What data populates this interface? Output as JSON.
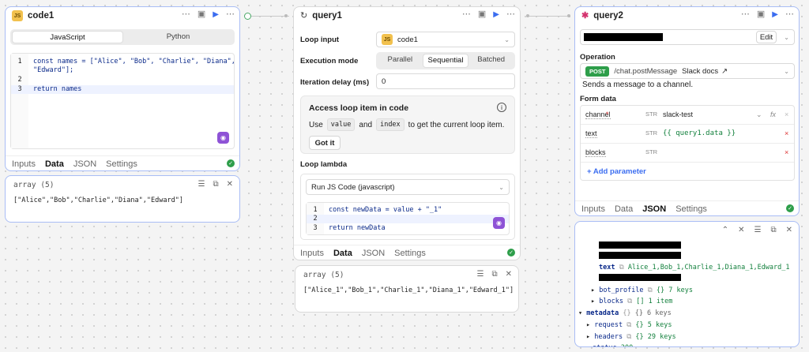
{
  "canvas_connectors": {
    "left_dot": "",
    "right_dot": ""
  },
  "code1": {
    "title": "code1",
    "lang_tabs": [
      "JavaScript",
      "Python"
    ],
    "code_lines": [
      {
        "n": "1",
        "text": "const names = [\"Alice\", \"Bob\", \"Charlie\", \"Diana\","
      },
      {
        "n": "",
        "text": "\"Edward\"];"
      },
      {
        "n": "2",
        "text": ""
      },
      {
        "n": "3",
        "text": "return names"
      }
    ],
    "bottom_tabs": [
      "Inputs",
      "Data",
      "JSON",
      "Settings"
    ],
    "active_tab": "Data",
    "result_header": "array (5)",
    "result_text": "[\"Alice\",\"Bob\",\"Charlie\",\"Diana\",\"Edward\"]"
  },
  "query1": {
    "title": "query1",
    "loop_input_label": "Loop input",
    "loop_input_value": "code1",
    "execution_mode_label": "Execution mode",
    "execution_modes": [
      "Parallel",
      "Sequential",
      "Batched"
    ],
    "execution_mode_selected": "Sequential",
    "iteration_delay_label": "Iteration delay (ms)",
    "iteration_delay_value": "0",
    "info_title": "Access loop item in code",
    "info_use": "Use",
    "info_value_chip": "value",
    "info_and": "and",
    "info_index_chip": "index",
    "info_rest": "to get the current loop item.",
    "got_it": "Got it",
    "loop_lambda_label": "Loop lambda",
    "lambda_select": "Run JS Code (javascript)",
    "lambda_lines": [
      {
        "n": "1",
        "text": "const newData = value + \"_1\""
      },
      {
        "n": "2",
        "text": ""
      },
      {
        "n": "3",
        "text": "return newData"
      }
    ],
    "bottom_tabs": [
      "Inputs",
      "Data",
      "JSON",
      "Settings"
    ],
    "active_tab": "Data",
    "result_header": "array (5)",
    "result_text": "[\"Alice_1\",\"Bob_1\",\"Charlie_1\",\"Diana_1\",\"Edward_1\"]"
  },
  "query2": {
    "title": "query2",
    "edit": "Edit",
    "operation_label": "Operation",
    "method": "POST",
    "endpoint": "/chat.postMessage",
    "docs": "Slack docs",
    "description": "Sends a message to a channel.",
    "form_data_label": "Form data",
    "rows": [
      {
        "key": "channel",
        "type": "STR",
        "value": "slack-test"
      },
      {
        "key": "text",
        "type": "STR",
        "value": "{{ query1.data }}"
      },
      {
        "key": "blocks",
        "type": "STR",
        "value": ""
      }
    ],
    "add_param": "+ Add parameter",
    "bottom_tabs": [
      "Inputs",
      "Data",
      "JSON",
      "Settings"
    ],
    "active_tab": "JSON",
    "json_tree": {
      "text_key": "text",
      "text_value": "Alice_1,Bob_1,Charlie_1,Diana_1,Edward_1",
      "bot_profile": "bot_profile",
      "bot_profile_info": "{}  7 keys",
      "blocks": "blocks",
      "blocks_info": "[]  1 item",
      "metadata": "metadata",
      "metadata_info": "{}  6 keys",
      "request": "request",
      "request_info": "{}  5 keys",
      "headers": "headers",
      "headers_info": "{}  29 keys",
      "status": "status",
      "status_info": "200"
    }
  }
}
